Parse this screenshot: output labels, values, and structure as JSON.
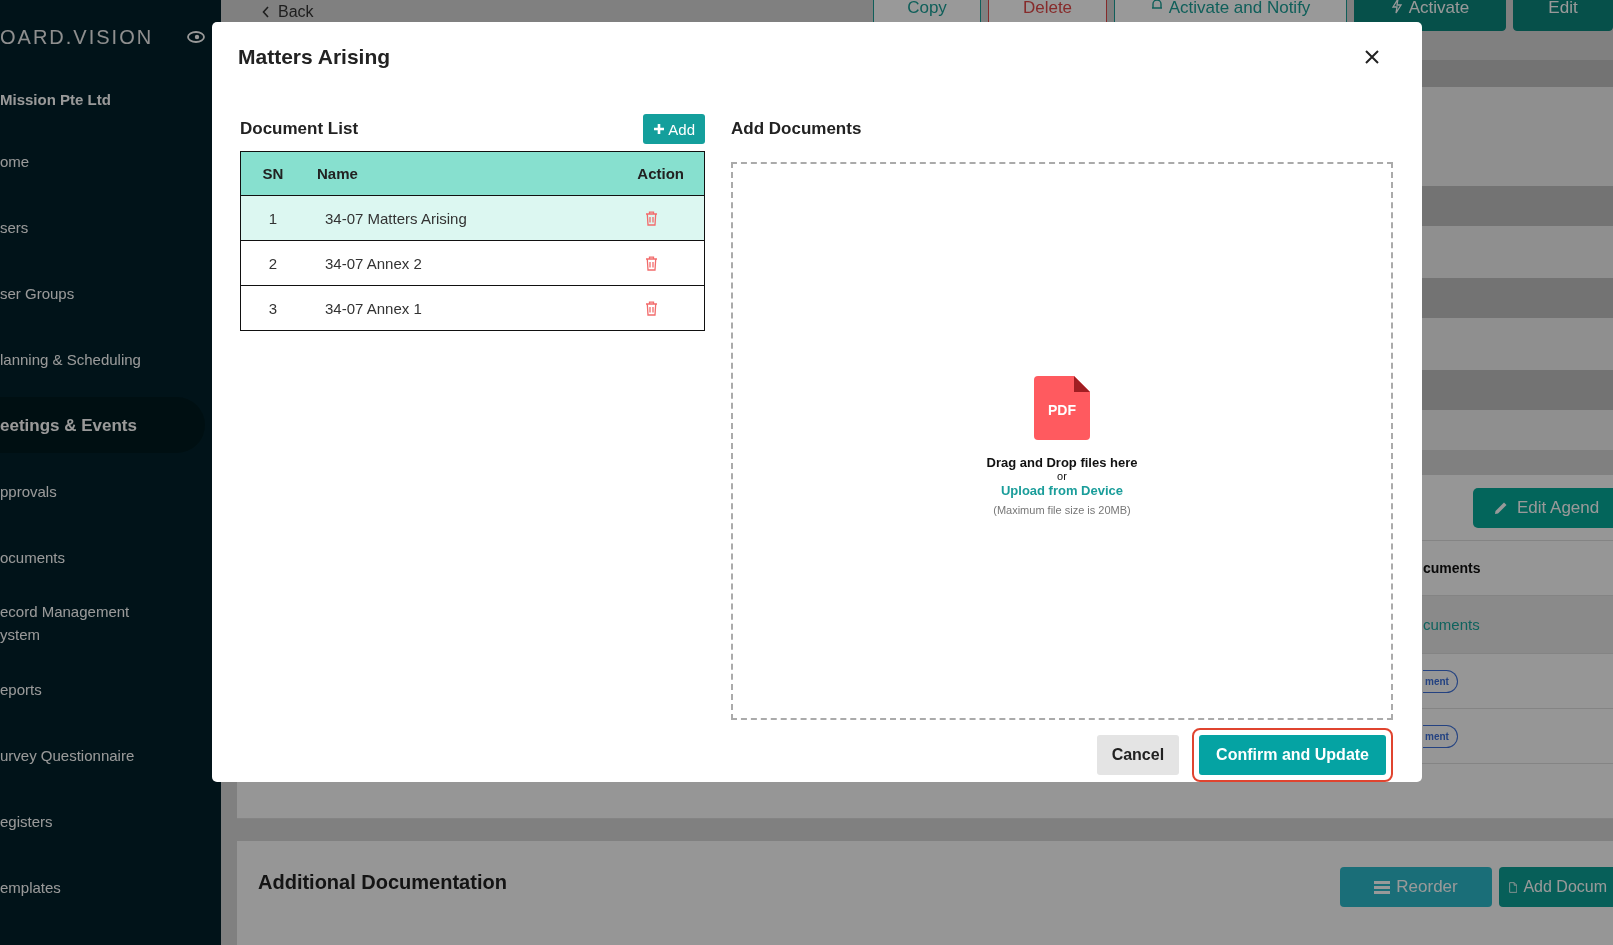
{
  "sidebar": {
    "logo": "OARD.VISION",
    "organization": "Mission Pte Ltd",
    "items": [
      {
        "label": "ome",
        "selected": false
      },
      {
        "label": "sers",
        "selected": false
      },
      {
        "label": "ser Groups",
        "selected": false
      },
      {
        "label": "lanning & Scheduling",
        "selected": false
      },
      {
        "label": "eetings & Events",
        "selected": true
      },
      {
        "label": "pprovals",
        "selected": false
      },
      {
        "label": "ocuments",
        "selected": false
      },
      {
        "label": "ecord Management\nystem",
        "selected": false
      },
      {
        "label": "eports",
        "selected": false
      },
      {
        "label": "urvey Questionnaire",
        "selected": false
      },
      {
        "label": "egisters",
        "selected": false
      },
      {
        "label": "emplates",
        "selected": false
      }
    ]
  },
  "top_bar": {
    "back": "Back",
    "buttons": [
      {
        "label": "Copy",
        "kind": "copy"
      },
      {
        "label": "Delete",
        "kind": "delete"
      },
      {
        "label": "Activate and Notify",
        "kind": "notify"
      },
      {
        "label": "Activate",
        "kind": "activate"
      },
      {
        "label": "Edit",
        "kind": "edit"
      }
    ]
  },
  "agenda": {
    "edit_button": "Edit Agend",
    "documents_heading": "cuments",
    "documents_link": "cuments",
    "badges": [
      "ment",
      "ment"
    ]
  },
  "additional": {
    "title": "Additional Documentation",
    "buttons": [
      {
        "label": "Reorder",
        "kind": "reorder"
      },
      {
        "label": "Add Docum",
        "kind": "add"
      }
    ]
  },
  "dialog": {
    "title": "Matters Arising",
    "document_list": {
      "heading": "Document List",
      "add_button": "Add",
      "columns": [
        "SN",
        "Name",
        "Action"
      ],
      "rows": [
        {
          "sn": "1",
          "name": "34-07 Matters Arising",
          "selected": true
        },
        {
          "sn": "2",
          "name": "34-07 Annex 2",
          "selected": false
        },
        {
          "sn": "3",
          "name": "34-07 Annex 1",
          "selected": false
        }
      ]
    },
    "add_documents": {
      "heading": "Add Documents",
      "file_type": "PDF",
      "drop_text": "Drag and Drop files here",
      "or": "or",
      "upload_link": "Upload from Device",
      "size_note": "(Maximum file size is 20MB)"
    },
    "buttons": [
      {
        "label": "Cancel",
        "kind": "secondary",
        "highlighted": false
      },
      {
        "label": "Confirm and Update",
        "kind": "primary",
        "highlighted": true
      }
    ]
  }
}
